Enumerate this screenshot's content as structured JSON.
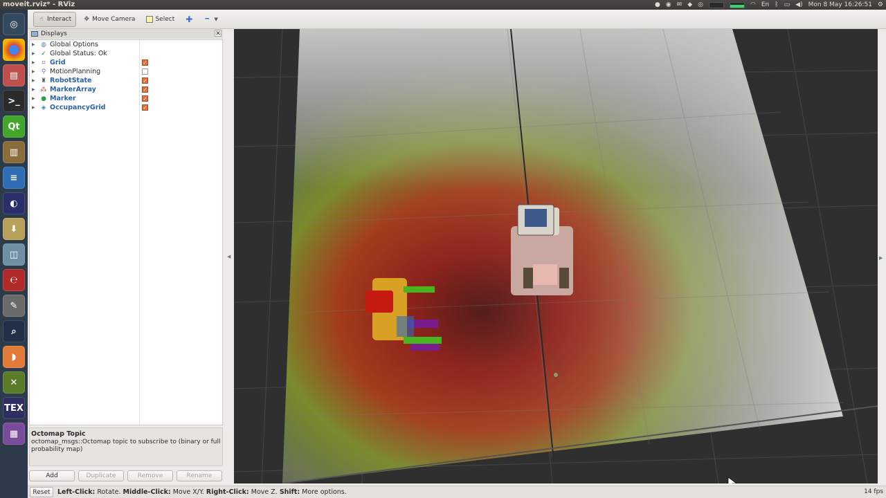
{
  "window": {
    "title": "moveit.rviz* - RViz"
  },
  "panel_indicators": {
    "keyboard": "En",
    "clock": "Mon 8 May 16:26:51"
  },
  "toolbar": {
    "interact": "Interact",
    "move_camera": "Move Camera",
    "select": "Select"
  },
  "displays": {
    "title": "Displays",
    "items": [
      {
        "label": "Global Options",
        "icon": "globe-icon",
        "checked": null,
        "highlight": false
      },
      {
        "label": "Global Status: Ok",
        "icon": "checkmark-icon",
        "checked": null,
        "highlight": false
      },
      {
        "label": "Grid",
        "icon": "grid-icon",
        "checked": true,
        "highlight": true
      },
      {
        "label": "MotionPlanning",
        "icon": "planning-icon",
        "checked": false,
        "highlight": false
      },
      {
        "label": "RobotState",
        "icon": "robot-icon",
        "checked": true,
        "highlight": true
      },
      {
        "label": "MarkerArray",
        "icon": "marker-array-icon",
        "checked": true,
        "highlight": true
      },
      {
        "label": "Marker",
        "icon": "marker-icon",
        "checked": true,
        "highlight": true
      },
      {
        "label": "OccupancyGrid",
        "icon": "occupancy-grid-icon",
        "checked": true,
        "highlight": true
      }
    ]
  },
  "description": {
    "title": "Octomap Topic",
    "text": "octomap_msgs::Octomap topic to subscribe to (binary or full probability map)"
  },
  "buttons": {
    "add": "Add",
    "duplicate": "Duplicate",
    "remove": "Remove",
    "rename": "Rename"
  },
  "status": {
    "reset": "Reset",
    "left_click_key": "Left-Click:",
    "left_click_val": " Rotate. ",
    "middle_click_key": "Middle-Click:",
    "middle_click_val": " Move X/Y. ",
    "right_click_key": "Right-Click:",
    "right_click_val": " Move Z. ",
    "shift_key": "Shift:",
    "shift_val": " More options.",
    "fps": "14 fps"
  },
  "colors": {
    "accent": "#2a63a8",
    "checkbox": "#e86b3d",
    "launcher": "#2c3a4a"
  }
}
